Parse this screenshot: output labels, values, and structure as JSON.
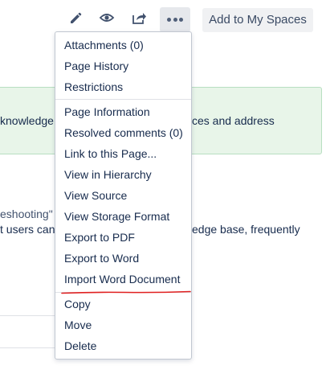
{
  "toolbar": {
    "edit_icon": "pencil-icon",
    "watch_icon": "eye-icon",
    "share_icon": "share-icon",
    "more_icon": "ellipsis-icon",
    "add_label": "Add to My Spaces"
  },
  "page": {
    "panel_text_left": "knowledge",
    "panel_text_right": "ces and address",
    "line1": "eshooting\"",
    "line2_left": "t users can",
    "line2_right": "edge base, frequently"
  },
  "menu": {
    "group1": [
      "Attachments (0)",
      "Page History",
      "Restrictions"
    ],
    "group2": [
      "Page Information",
      "Resolved comments (0)",
      "Link to this Page...",
      "View in Hierarchy",
      "View Source",
      "View Storage Format",
      "Export to PDF",
      "Export to Word",
      "Import Word Document"
    ],
    "group3": [
      "Copy",
      "Move",
      "Delete"
    ]
  },
  "colors": {
    "annotation_underline": "#e02020",
    "panel_bg": "#e8f5e9"
  }
}
